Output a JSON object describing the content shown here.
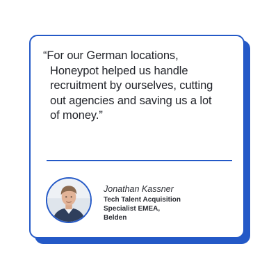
{
  "testimonial": {
    "quote_lines": [
      "“For our German locations,",
      "Honeypot helped us handle",
      "recruitment by ourselves, cutting",
      "out agencies and saving us a lot",
      "of money.”"
    ],
    "author": {
      "name": "Jonathan Kassner",
      "title_lines": [
        "Tech Talent Acquisition",
        "Specialist EMEA,",
        "Belden"
      ]
    }
  },
  "colors": {
    "accent": "#2459c7",
    "text": "#22242a",
    "background": "#ffffff"
  },
  "icons": {
    "avatar": "person-portrait"
  }
}
